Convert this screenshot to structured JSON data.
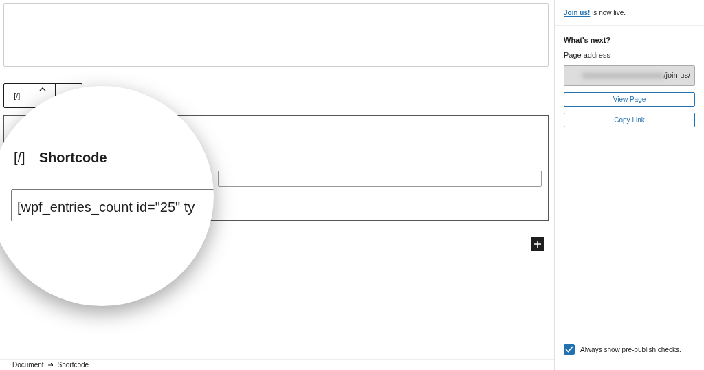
{
  "editor": {
    "block_toolbar": {
      "block_icon": "[/]"
    },
    "magnifier": {
      "block_icon": "[/]",
      "title": "Shortcode",
      "value": "[wpf_entries_count id=\"25\" ty"
    }
  },
  "sidebar": {
    "notice": {
      "link": "Join us!",
      "text": "is now live."
    },
    "heading": "What's next?",
    "address_label": "Page address",
    "address_value": "/join-us/",
    "buttons": [
      "View Page",
      "Copy Link"
    ],
    "prepublish": {
      "label": "Always show pre-publish checks.",
      "checked": true
    }
  },
  "breadcrumb": [
    "Document",
    "Shortcode"
  ]
}
